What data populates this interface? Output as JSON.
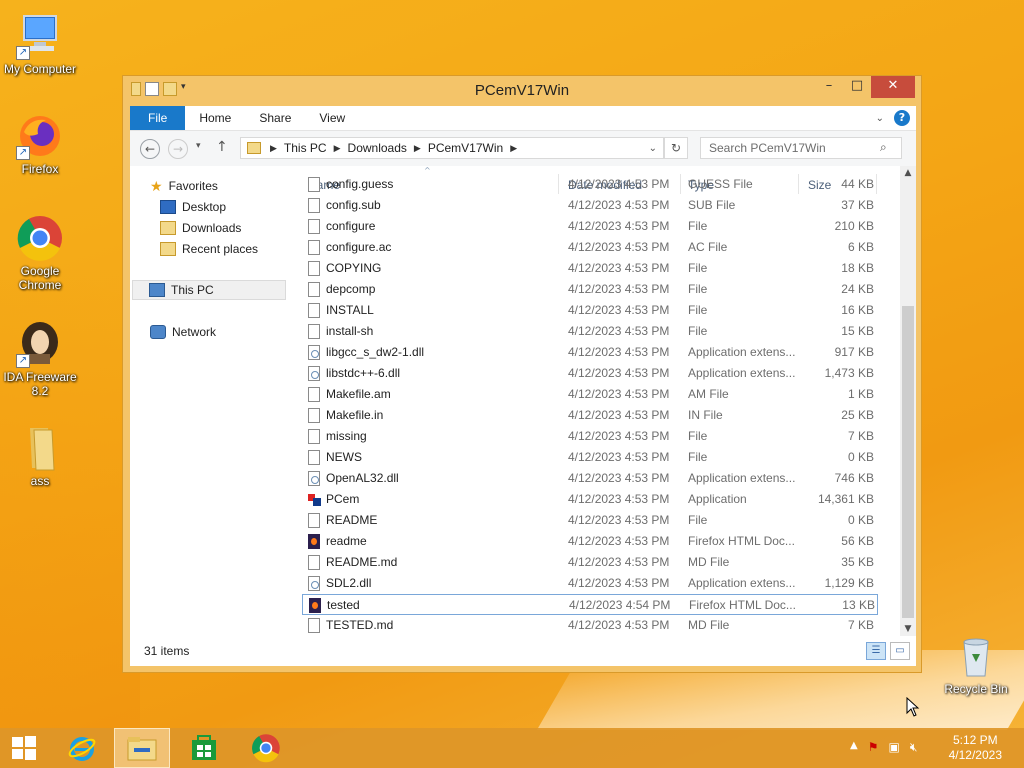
{
  "desktop": {
    "icons": [
      {
        "label": "My Computer"
      },
      {
        "label": "Firefox"
      },
      {
        "label": "Google Chrome"
      },
      {
        "label": "IDA Freeware 8.2"
      },
      {
        "label": "ass"
      },
      {
        "label": "Recycle Bin"
      }
    ]
  },
  "window": {
    "title": "PCemV17Win",
    "ribbon": {
      "tabs": [
        "File",
        "Home",
        "Share",
        "View"
      ],
      "help": "?"
    },
    "address": {
      "crumbs": [
        "This PC",
        "Downloads",
        "PCemV17Win"
      ]
    },
    "search": {
      "placeholder": "Search PCemV17Win"
    },
    "nav_pane": {
      "favorites": "Favorites",
      "desktop": "Desktop",
      "downloads": "Downloads",
      "recent": "Recent places",
      "this_pc": "This PC",
      "network": "Network"
    },
    "columns": {
      "name": "Name",
      "date": "Date modified",
      "type": "Type",
      "size": "Size"
    },
    "files": [
      {
        "name": "config.guess",
        "date": "4/12/2023 4:53 PM",
        "type": "GUESS File",
        "size": "44 KB",
        "icon": "file"
      },
      {
        "name": "config.sub",
        "date": "4/12/2023 4:53 PM",
        "type": "SUB File",
        "size": "37 KB",
        "icon": "file"
      },
      {
        "name": "configure",
        "date": "4/12/2023 4:53 PM",
        "type": "File",
        "size": "210 KB",
        "icon": "file"
      },
      {
        "name": "configure.ac",
        "date": "4/12/2023 4:53 PM",
        "type": "AC File",
        "size": "6 KB",
        "icon": "file"
      },
      {
        "name": "COPYING",
        "date": "4/12/2023 4:53 PM",
        "type": "File",
        "size": "18 KB",
        "icon": "file"
      },
      {
        "name": "depcomp",
        "date": "4/12/2023 4:53 PM",
        "type": "File",
        "size": "24 KB",
        "icon": "file"
      },
      {
        "name": "INSTALL",
        "date": "4/12/2023 4:53 PM",
        "type": "File",
        "size": "16 KB",
        "icon": "file"
      },
      {
        "name": "install-sh",
        "date": "4/12/2023 4:53 PM",
        "type": "File",
        "size": "15 KB",
        "icon": "file"
      },
      {
        "name": "libgcc_s_dw2-1.dll",
        "date": "4/12/2023 4:53 PM",
        "type": "Application extens...",
        "size": "917 KB",
        "icon": "dll"
      },
      {
        "name": "libstdc++-6.dll",
        "date": "4/12/2023 4:53 PM",
        "type": "Application extens...",
        "size": "1,473 KB",
        "icon": "dll"
      },
      {
        "name": "Makefile.am",
        "date": "4/12/2023 4:53 PM",
        "type": "AM File",
        "size": "1 KB",
        "icon": "file"
      },
      {
        "name": "Makefile.in",
        "date": "4/12/2023 4:53 PM",
        "type": "IN File",
        "size": "25 KB",
        "icon": "file"
      },
      {
        "name": "missing",
        "date": "4/12/2023 4:53 PM",
        "type": "File",
        "size": "7 KB",
        "icon": "file"
      },
      {
        "name": "NEWS",
        "date": "4/12/2023 4:53 PM",
        "type": "File",
        "size": "0 KB",
        "icon": "file"
      },
      {
        "name": "OpenAL32.dll",
        "date": "4/12/2023 4:53 PM",
        "type": "Application extens...",
        "size": "746 KB",
        "icon": "dll"
      },
      {
        "name": "PCem",
        "date": "4/12/2023 4:53 PM",
        "type": "Application",
        "size": "14,361 KB",
        "icon": "app"
      },
      {
        "name": "README",
        "date": "4/12/2023 4:53 PM",
        "type": "File",
        "size": "0 KB",
        "icon": "file"
      },
      {
        "name": "readme",
        "date": "4/12/2023 4:53 PM",
        "type": "Firefox HTML Doc...",
        "size": "56 KB",
        "icon": "ff"
      },
      {
        "name": "README.md",
        "date": "4/12/2023 4:53 PM",
        "type": "MD File",
        "size": "35 KB",
        "icon": "file"
      },
      {
        "name": "SDL2.dll",
        "date": "4/12/2023 4:53 PM",
        "type": "Application extens...",
        "size": "1,129 KB",
        "icon": "dll"
      },
      {
        "name": "tested",
        "date": "4/12/2023 4:54 PM",
        "type": "Firefox HTML Doc...",
        "size": "13 KB",
        "icon": "ff",
        "selected": true
      },
      {
        "name": "TESTED.md",
        "date": "4/12/2023 4:53 PM",
        "type": "MD File",
        "size": "7 KB",
        "icon": "file"
      }
    ],
    "status": {
      "item_count": "31 items"
    }
  },
  "taskbar": {
    "time": "5:12 PM",
    "date": "4/12/2023"
  },
  "colors": {
    "accent": "#1979ca",
    "close": "#c74c3c",
    "taskbar": "#de9628"
  }
}
